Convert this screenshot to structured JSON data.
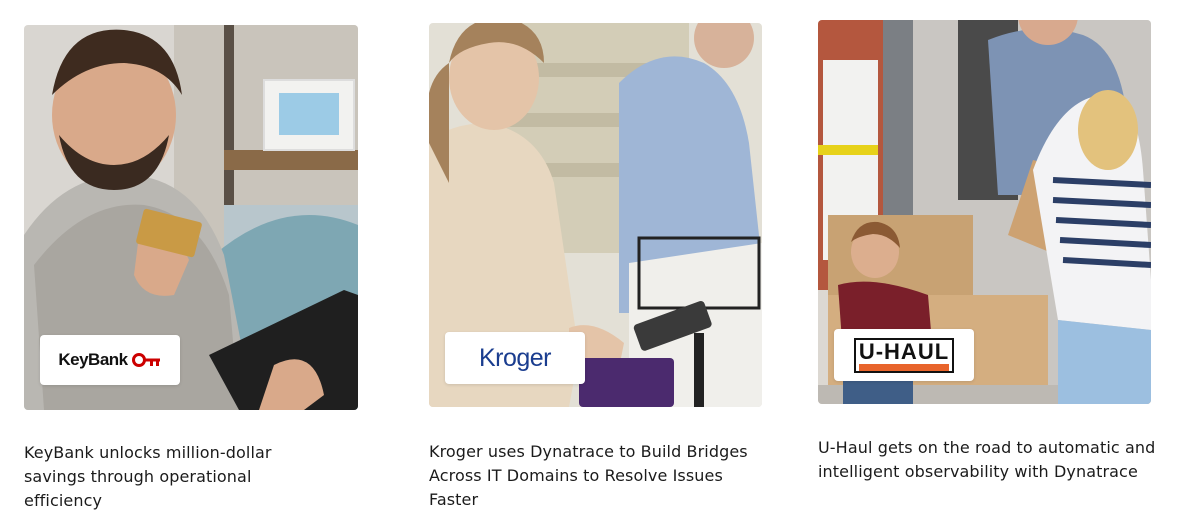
{
  "cards": [
    {
      "title": "KeyBank unlocks million-dollar savings through operational efficiency",
      "logo_text": "KeyBank",
      "logo_icon": "key-icon",
      "logo_color": "#cc0000"
    },
    {
      "title": "Kroger uses Dynatrace to Build Bridges Across IT Domains to Resolve Issues Faster",
      "logo_text": "Kroger",
      "logo_color": "#1a3d8f"
    },
    {
      "title": "U-Haul gets on the road to automatic and intelligent observability with Dynatrace",
      "logo_text": "U-HAUL",
      "logo_color": "#e8642b"
    }
  ]
}
